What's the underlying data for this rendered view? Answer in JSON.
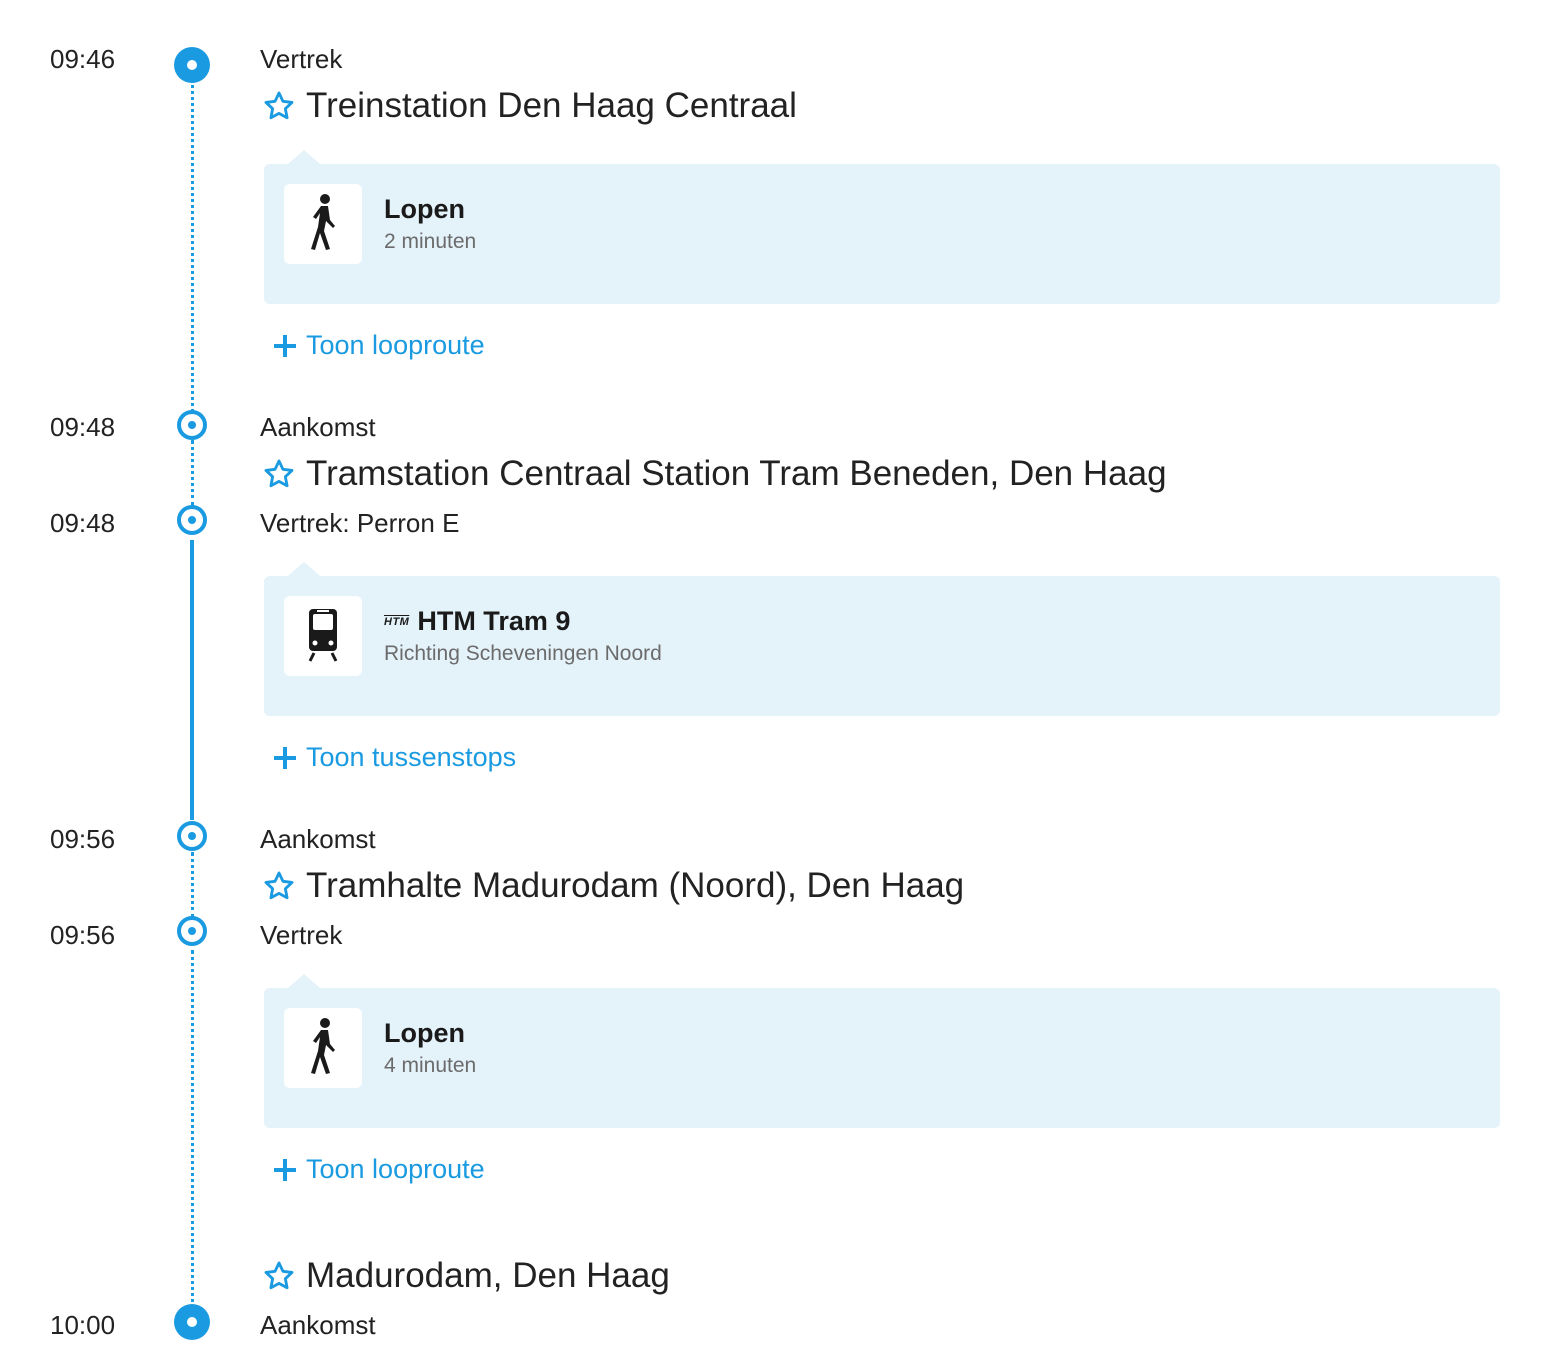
{
  "accent": "#1a9ae0",
  "stops": [
    {
      "time": "09:46",
      "label": "Vertrek",
      "station": "Treinstation Den Haag Centraal"
    },
    {
      "time": "09:48",
      "label": "Aankomst",
      "station": "Tramstation Centraal Station Tram Beneden, Den Haag"
    },
    {
      "time": "09:48",
      "label": "Vertrek: Perron E"
    },
    {
      "time": "09:56",
      "label": "Aankomst",
      "station": "Tramhalte Madurodam (Noord), Den Haag"
    },
    {
      "time": "09:56",
      "label": "Vertrek"
    },
    {
      "time": "10:00",
      "label": "Aankomst",
      "station": "Madurodam, Den Haag"
    }
  ],
  "legs": [
    {
      "icon": "walk-icon",
      "title": "Lopen",
      "subtitle": "2 minuten",
      "toggle": "Toon looproute"
    },
    {
      "icon": "tram-icon",
      "operator": "HTM",
      "title": "HTM Tram 9",
      "subtitle": "Richting Scheveningen Noord",
      "toggle": "Toon tussenstops"
    },
    {
      "icon": "walk-icon",
      "title": "Lopen",
      "subtitle": "4 minuten",
      "toggle": "Toon looproute"
    }
  ]
}
